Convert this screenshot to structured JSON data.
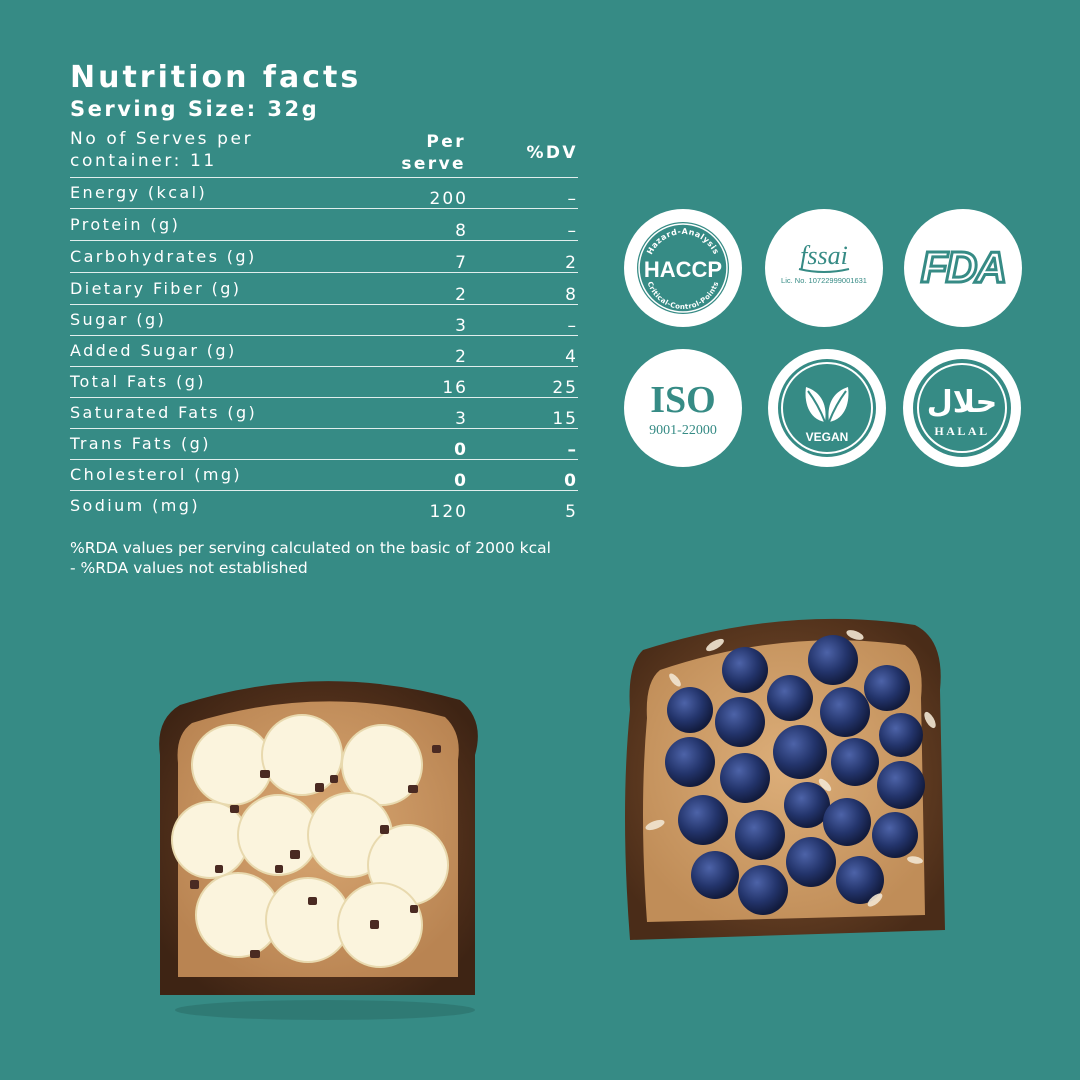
{
  "nutrition": {
    "title": "Nutrition facts",
    "serving_size": "Serving Size: 32g",
    "serves_per_container": "No of Serves per container: 11",
    "col_per_serve": "Per serve",
    "col_dv": "%DV",
    "rows": [
      {
        "label": "Energy (kcal)",
        "per_serve": "200",
        "dv": "–"
      },
      {
        "label": "Protein (g)",
        "per_serve": "8",
        "dv": "–"
      },
      {
        "label": "Carbohydrates (g)",
        "per_serve": "7",
        "dv": "2"
      },
      {
        "label": "Dietary Fiber (g)",
        "per_serve": "2",
        "dv": "8"
      },
      {
        "label": "Sugar (g)",
        "per_serve": "3",
        "dv": "–"
      },
      {
        "label": "Added Sugar (g)",
        "per_serve": "2",
        "dv": "4"
      },
      {
        "label": "Total Fats (g)",
        "per_serve": "16",
        "dv": "25"
      },
      {
        "label": "Saturated Fats (g)",
        "per_serve": "3",
        "dv": "15"
      },
      {
        "label": "Trans Fats (g)",
        "per_serve": "0",
        "dv": "–"
      },
      {
        "label": "Cholesterol (mg)",
        "per_serve": "0",
        "dv": "0"
      },
      {
        "label": "Sodium (mg)",
        "per_serve": "120",
        "dv": "5"
      }
    ],
    "footnote_line1": "%RDA values per serving calculated on the basic of 2000 kcal",
    "footnote_line2": "- %RDA values not established"
  },
  "certifications": {
    "haccp": {
      "label": "HACCP",
      "arc_top": "Hazard-Analysis",
      "arc_bottom": "Critical-Control-Points"
    },
    "fssai": {
      "label": "fssai",
      "license": "Lic. No. 10722999001631"
    },
    "fda": {
      "label": "FDA"
    },
    "iso": {
      "label": "ISO",
      "number": "9001-22000"
    },
    "vegan": {
      "label": "VEGAN"
    },
    "halal": {
      "label": "HALAL",
      "arabic": "حلال"
    }
  },
  "colors": {
    "background": "#368b85",
    "badge_fill": "#ffffff",
    "badge_mark": "#368b85"
  }
}
